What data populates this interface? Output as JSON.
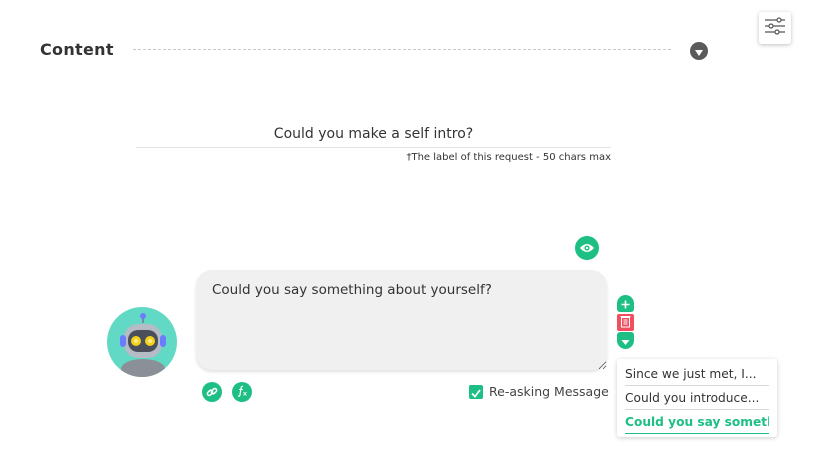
{
  "section": {
    "title": "Content"
  },
  "request": {
    "label_value": "Could you make a self intro?",
    "label_hint": "†The label of this request - 50 chars max"
  },
  "message": {
    "text": "Could you say something about yourself?",
    "reasking_label": "Re-asking Message",
    "reasking_checked": true
  },
  "variations": [
    {
      "label": "Since we just met, I..."
    },
    {
      "label": "Could you introduce..."
    },
    {
      "label": "Could you say someth...",
      "active": true
    }
  ],
  "icons": {
    "settings": "sliders-icon",
    "collapse": "chevron-down-icon",
    "preview": "eye-icon",
    "add": "plus-icon",
    "delete": "trash-icon",
    "move_down": "chevron-down-icon",
    "link": "link-icon",
    "function": "function-icon"
  },
  "colors": {
    "accent": "#1dbf84",
    "danger": "#ef4f5e",
    "avatar_bg": "#61d9c5",
    "eye_yellow": "#f4d21c"
  }
}
